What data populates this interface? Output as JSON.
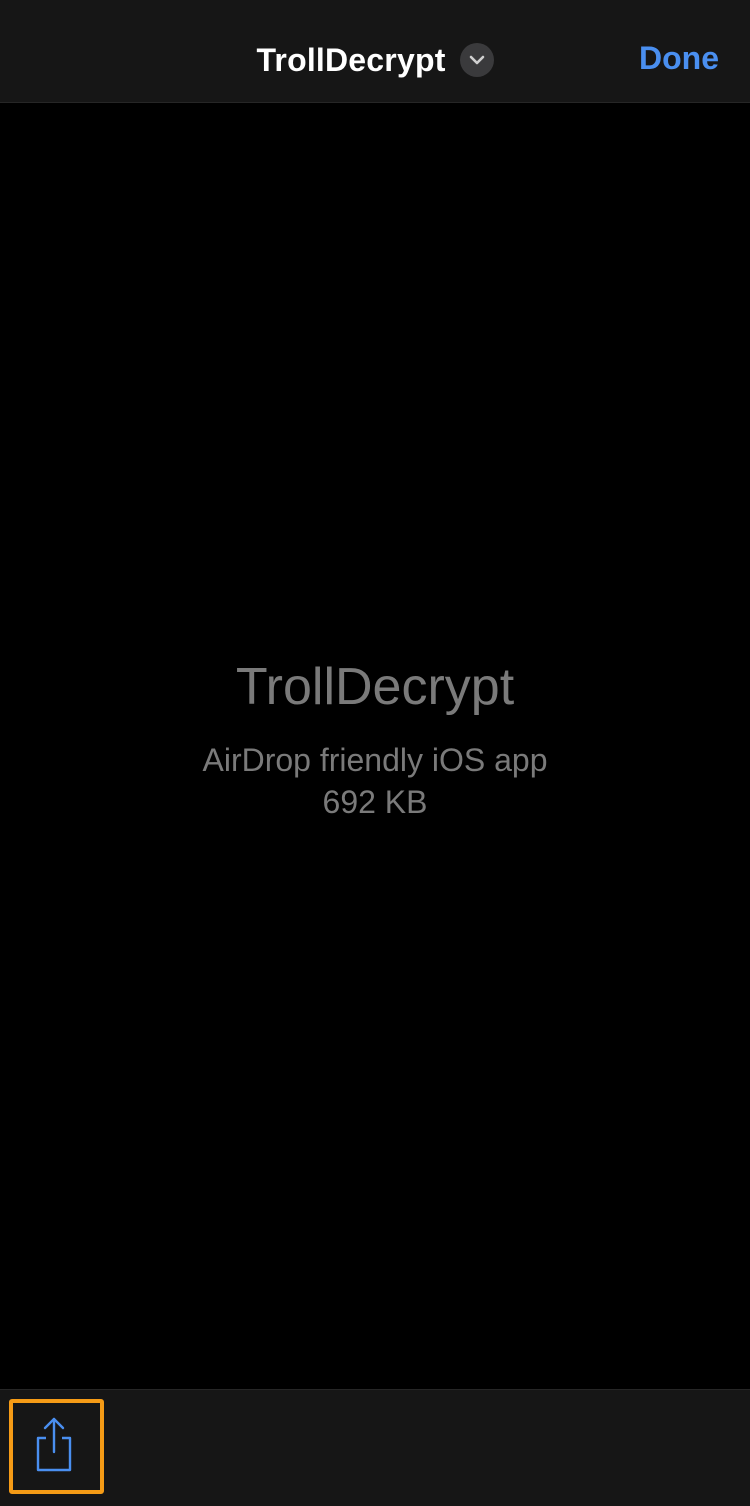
{
  "nav": {
    "title": "TrollDecrypt",
    "done_label": "Done",
    "chevron_icon": "chevron-down-icon"
  },
  "preview": {
    "file_name": "TrollDecrypt",
    "file_kind": "AirDrop friendly iOS app",
    "file_size": "692 KB"
  },
  "toolbar": {
    "share_icon": "share-icon",
    "highlight_color": "#f59b16"
  },
  "colors": {
    "accent": "#4a8ff0",
    "background": "#000000",
    "bar": "#161616",
    "secondary_text": "#7a7a7a"
  }
}
